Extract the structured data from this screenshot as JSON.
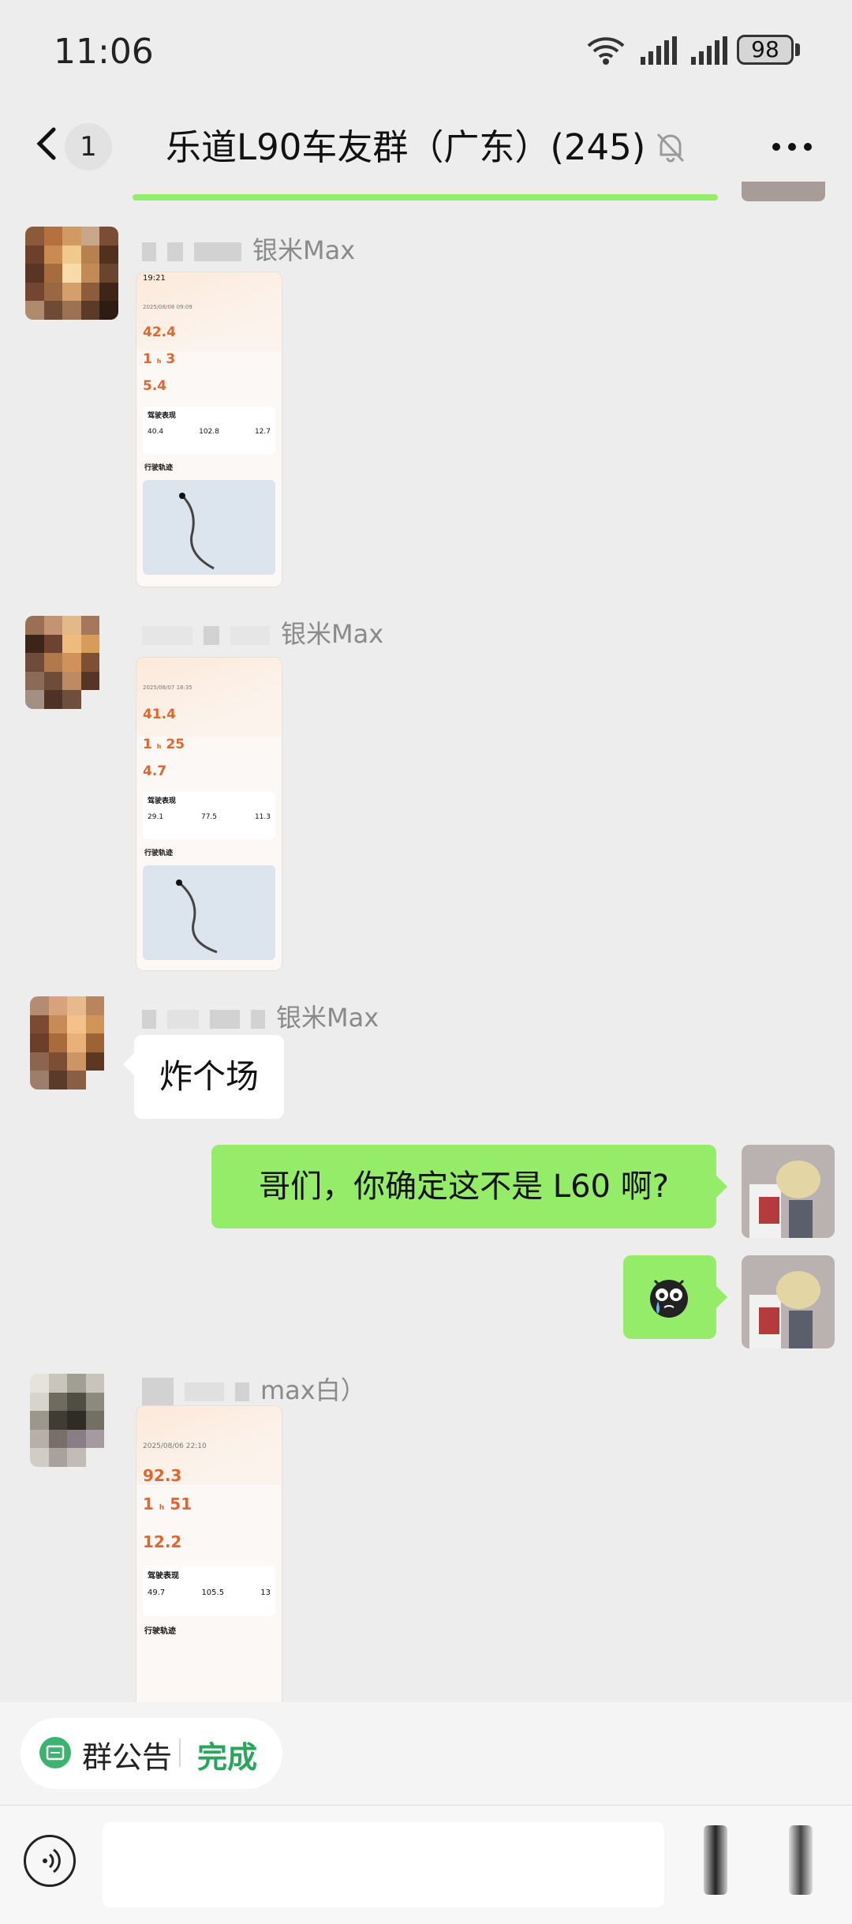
{
  "status_bar": {
    "time": "11:06",
    "battery": "98"
  },
  "header": {
    "unread_count": "1",
    "title": "乐道L90车友群（广东）(245)"
  },
  "messages": [
    {
      "sender_suffix": "银米Max",
      "screenshot": {
        "time": "19:21",
        "date": "2025/08/08 09:09",
        "distance": "42.4",
        "duration_h": "1",
        "duration_m": "3",
        "consumption": "5.4",
        "section": "驾驶表现",
        "metrics": [
          "40.4",
          "102.8",
          "12.7"
        ],
        "track": "行驶轨迹"
      }
    },
    {
      "sender_suffix": "银米Max",
      "screenshot": {
        "date": "2025/08/07 18:35",
        "distance": "41.4",
        "duration_h": "1",
        "duration_m": "25",
        "consumption": "4.7",
        "section": "驾驶表现",
        "metrics": [
          "29.1",
          "77.5",
          "11.3"
        ],
        "track": "行驶轨迹"
      }
    },
    {
      "sender_suffix": "银米Max",
      "text": "炸个场"
    },
    {
      "own": true,
      "text": "哥们，你确定这不是 L60 啊?"
    },
    {
      "own": true,
      "sticker": "crying-face"
    },
    {
      "sender_suffix": "max白）",
      "screenshot": {
        "date": "2025/08/06 22:10",
        "distance": "92.3",
        "duration_h": "1",
        "duration_m": "51",
        "consumption": "12.2",
        "section": "驾驶表现",
        "metrics": [
          "49.7",
          "105.5",
          "13"
        ],
        "track": "行驶轨迹"
      }
    }
  ],
  "notice": {
    "label": "群公告",
    "done": "完成"
  },
  "input": {
    "value": ""
  },
  "colors": {
    "bubble_green": "#95ec69",
    "background": "#ededed",
    "accent_orange": "#e0662d",
    "done_green": "#2aa55b"
  }
}
